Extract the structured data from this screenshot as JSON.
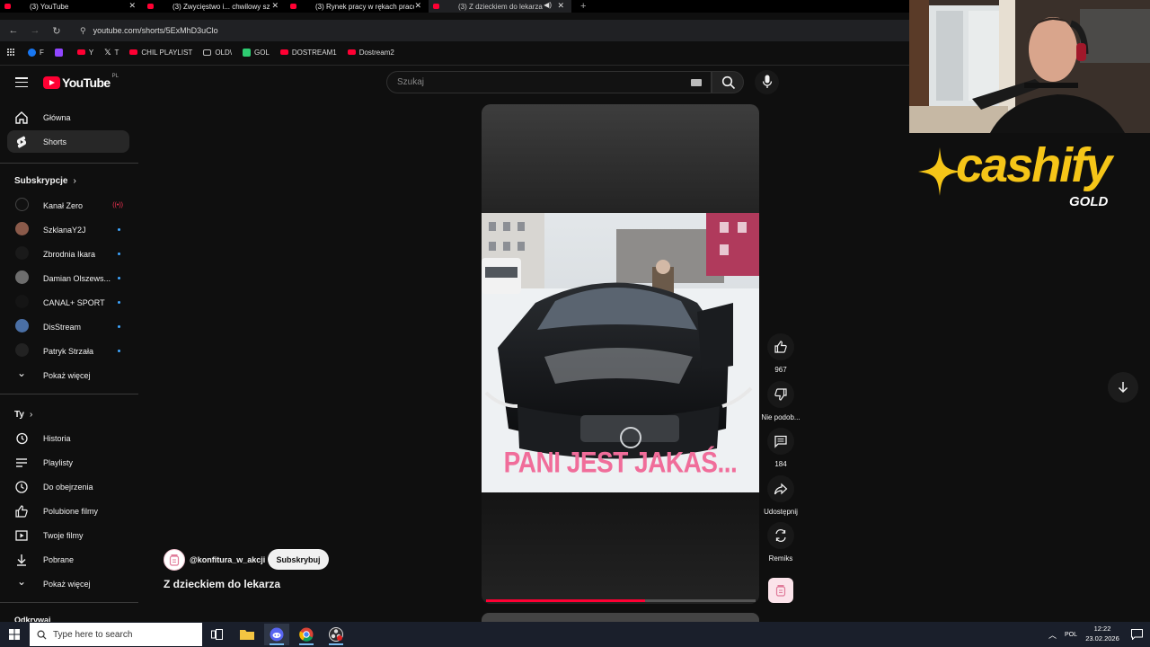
{
  "browser": {
    "tabs": [
      {
        "title": "(3) YouTube",
        "active": false
      },
      {
        "title": "(3) Zwycięstwo i... chwilowy sz",
        "active": false
      },
      {
        "title": "(3) Rynek pracy w rękach praco",
        "active": false
      },
      {
        "title": "(3) Z dzieckiem do lekarza -",
        "active": true
      }
    ],
    "url": "youtube.com/shorts/5ExMhD3uClo",
    "bookmarks": [
      {
        "label": "F",
        "color": "#1877f2"
      },
      {
        "label": "",
        "color": "#9146ff"
      },
      {
        "label": "Y",
        "color": "#ff0033"
      },
      {
        "label": "T",
        "color": "#ffffff"
      },
      {
        "label": "CHIL PLAYLIST",
        "color": "#ff0033"
      },
      {
        "label": "OLD\\",
        "color": "#bbbbbb"
      },
      {
        "label": "GOL",
        "color": "#2ecc71"
      },
      {
        "label": "DOSTREAM1",
        "color": "#ff0033"
      },
      {
        "label": "Dostream2",
        "color": "#ff0033"
      }
    ]
  },
  "youtube": {
    "logo_word": "YouTube",
    "country_code": "PL",
    "search_placeholder": "Szukaj",
    "sidebar": {
      "main": [
        {
          "label": "Główna",
          "icon": "home-icon"
        },
        {
          "label": "Shorts",
          "icon": "shorts-icon",
          "active": true
        }
      ],
      "subscriptions_header": "Subskrypcje",
      "subscriptions": [
        {
          "label": "Kanał Zero",
          "live": true
        },
        {
          "label": "SzklanaY2J",
          "dot": true
        },
        {
          "label": "Zbrodnia Ikara",
          "dot": true
        },
        {
          "label": "Damian Olszews...",
          "dot": true
        },
        {
          "label": "CANAL+ SPORT",
          "dot": true
        },
        {
          "label": "DisStream",
          "dot": true
        },
        {
          "label": "Patryk Strzała",
          "dot": true
        }
      ],
      "show_more": "Pokaż więcej",
      "you_header": "Ty",
      "you": [
        {
          "label": "Historia",
          "icon": "history-icon"
        },
        {
          "label": "Playlisty",
          "icon": "playlists-icon"
        },
        {
          "label": "Do obejrzenia",
          "icon": "watch-later-icon"
        },
        {
          "label": "Polubione filmy",
          "icon": "thumb-up-icon"
        },
        {
          "label": "Twoje filmy",
          "icon": "your-videos-icon"
        },
        {
          "label": "Pobrane",
          "icon": "download-icon"
        }
      ],
      "show_more_2": "Pokaż więcej",
      "cut_off_label": "Odkrywaj"
    },
    "short": {
      "caption": "PANI JEST JAKAŚ...",
      "channel": "@konfitura_w_akcji",
      "subscribe": "Subskrybuj",
      "title": "Z dzieckiem do lekarza",
      "progress": 0.59,
      "actions": {
        "likes": "967",
        "dislike": "Nie podob...",
        "comments": "184",
        "share": "Udostępnij",
        "remix": "Remiks"
      }
    }
  },
  "overlay": {
    "brand": "cashify",
    "sub": "GOLD",
    "brand_color": "#f5c518"
  },
  "taskbar": {
    "search_placeholder": "Type here to search",
    "language": "POL",
    "time": "12:22",
    "date": "23.02.2026"
  }
}
